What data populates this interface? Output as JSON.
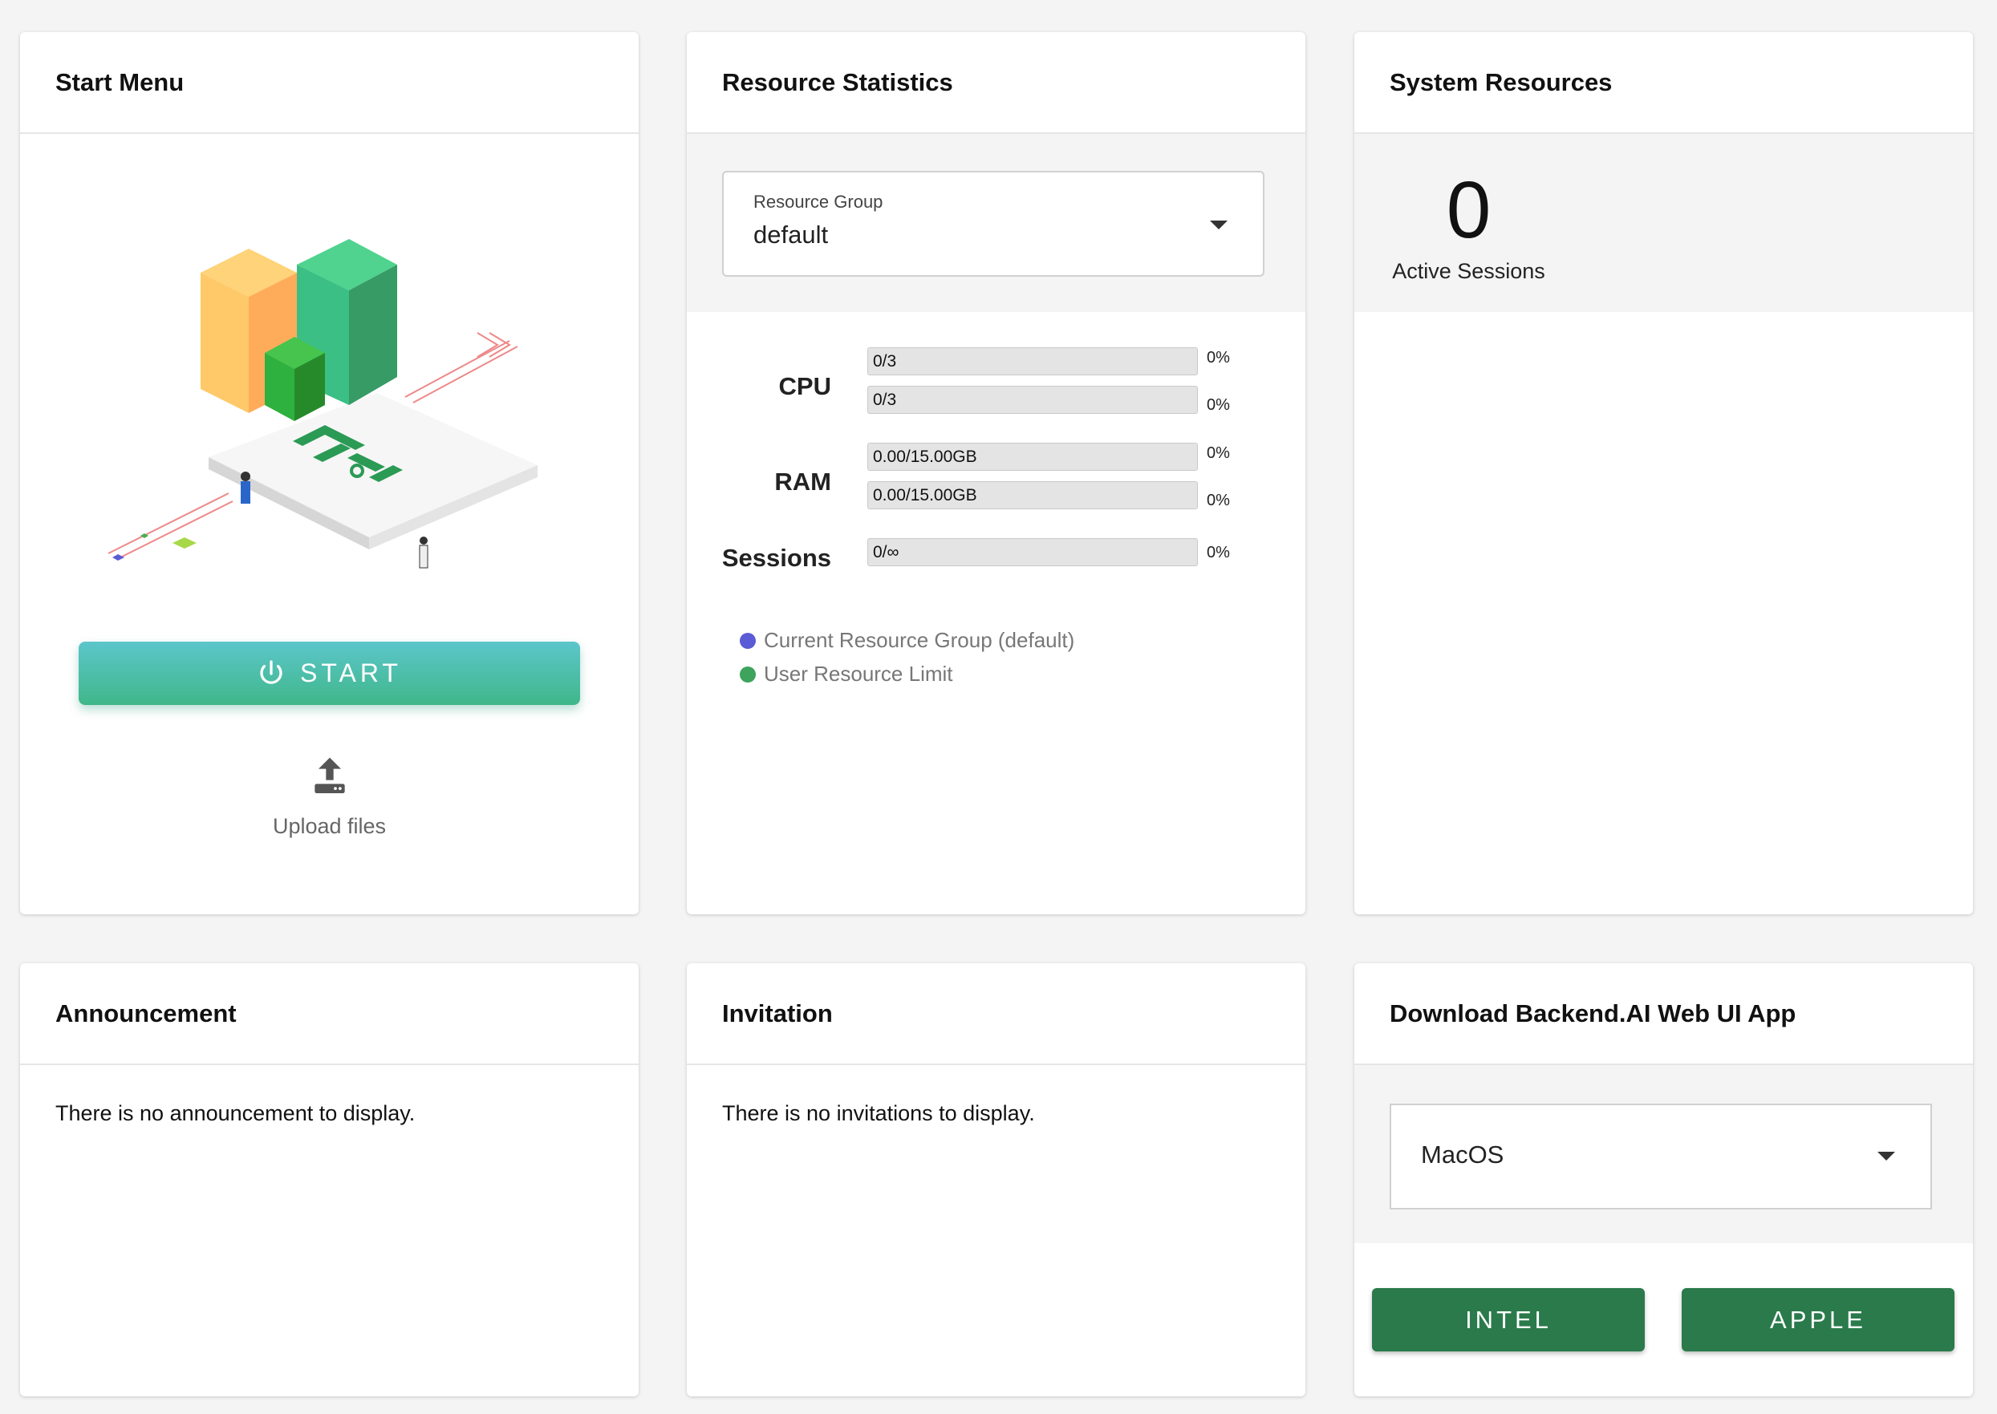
{
  "start_menu": {
    "title": "Start Menu",
    "start_label": "START",
    "upload_label": "Upload files"
  },
  "resource_statistics": {
    "title": "Resource Statistics",
    "resource_group": {
      "caption": "Resource Group",
      "value": "default"
    },
    "rows": [
      {
        "label": "CPU",
        "bars": [
          {
            "text": "0/3",
            "percent": "0%"
          },
          {
            "text": "0/3",
            "percent": "0%"
          }
        ]
      },
      {
        "label": "RAM",
        "bars": [
          {
            "text": "0.00/15.00GB",
            "percent": "0%"
          },
          {
            "text": "0.00/15.00GB",
            "percent": "0%"
          }
        ]
      },
      {
        "label": "Sessions",
        "bars": [
          {
            "text": "0/∞",
            "percent": "0%"
          }
        ]
      }
    ],
    "legend": [
      {
        "label": "Current Resource Group (default)",
        "color": "#5b5bd6"
      },
      {
        "label": "User Resource Limit",
        "color": "#3da35d"
      }
    ]
  },
  "system_resources": {
    "title": "System Resources",
    "active_sessions_value": "0",
    "active_sessions_label": "Active Sessions"
  },
  "announcement": {
    "title": "Announcement",
    "message": "There is no announcement to display."
  },
  "invitation": {
    "title": "Invitation",
    "message": "There is no invitations to display."
  },
  "download_app": {
    "title": "Download Backend.AI Web UI App",
    "os_selected": "MacOS",
    "buttons": {
      "intel": "INTEL",
      "apple": "APPLE"
    }
  },
  "colors": {
    "accent_green": "#2a7a4b",
    "start_gradient_top": "#5cc6cb",
    "start_gradient_bottom": "#3fb78a"
  }
}
